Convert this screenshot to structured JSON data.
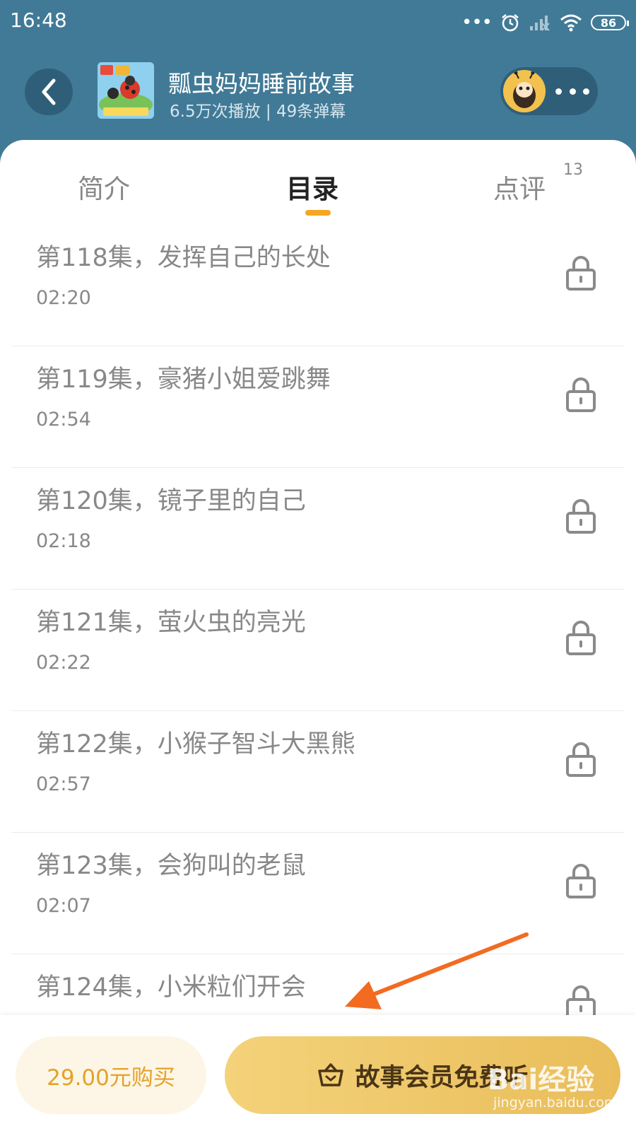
{
  "status_bar": {
    "time": "16:48",
    "battery": "86"
  },
  "header": {
    "title": "瓢虫妈妈睡前故事",
    "subtitle": "6.5万次播放 | 49条弹幕"
  },
  "tabs": [
    {
      "label": "简介"
    },
    {
      "label": "目录"
    },
    {
      "label": "点评",
      "badge": "13"
    }
  ],
  "episodes": [
    {
      "title": "第118集，发挥自己的长处",
      "duration": "02:20"
    },
    {
      "title": "第119集，豪猪小姐爱跳舞",
      "duration": "02:54"
    },
    {
      "title": "第120集，镜子里的自己",
      "duration": "02:18"
    },
    {
      "title": "第121集，萤火虫的亮光",
      "duration": "02:22"
    },
    {
      "title": "第122集，小猴子智斗大黑熊",
      "duration": "02:57"
    },
    {
      "title": "第123集，会狗叫的老鼠",
      "duration": "02:07"
    },
    {
      "title": "第124集，小米粒们开会",
      "duration": ""
    }
  ],
  "bottom": {
    "buy_label": "29.00元购买",
    "member_label": "故事会员免费听"
  },
  "watermark": {
    "main": "Bai经验",
    "sub": "jingyan.baidu.com"
  },
  "colors": {
    "header_bg": "#417a96",
    "accent": "#f5a623",
    "member_btn": "#e9bd5a"
  }
}
